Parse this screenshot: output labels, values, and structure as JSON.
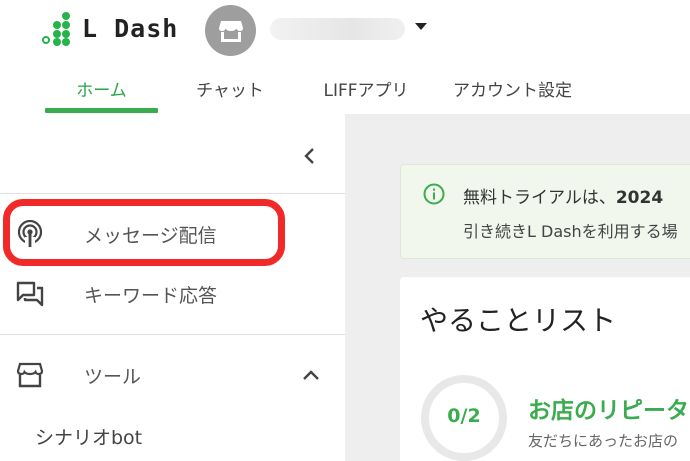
{
  "brand": {
    "logo_text": "L Dash",
    "logo_icon": "logo-dots-icon",
    "accent_color": "#3aac4f"
  },
  "account": {
    "avatar_icon": "store-icon",
    "name": "",
    "dropdown_icon": "caret-down-icon"
  },
  "tabs": [
    {
      "label": "ホーム",
      "active": true
    },
    {
      "label": "チャット",
      "active": false
    },
    {
      "label": "LIFFアプリ",
      "active": false
    },
    {
      "label": "アカウント設定",
      "active": false
    }
  ],
  "sidebar": {
    "collapse_icon": "chevron-left-icon",
    "items": [
      {
        "label": "メッセージ配信",
        "icon": "broadcast-icon",
        "highlighted": true
      },
      {
        "label": "キーワード応答",
        "icon": "chat-bubbles-icon"
      }
    ],
    "tools": {
      "label": "ツール",
      "icon": "store-icon",
      "expanded": true,
      "sub_items": [
        {
          "label": "シナリオbot"
        }
      ]
    },
    "highlight_color": "#f22929"
  },
  "main": {
    "trial_notice": {
      "icon": "info-icon",
      "line1_prefix": "無料トライアルは、",
      "line1_bold": "2024",
      "line2": "引き続きL Dashを利用する場"
    },
    "todo": {
      "title": "やることリスト",
      "progress_text": "0/2",
      "progress_fraction": 0,
      "task_title": "お店のリピータ",
      "task_desc": "友だちにあったお店の"
    }
  }
}
